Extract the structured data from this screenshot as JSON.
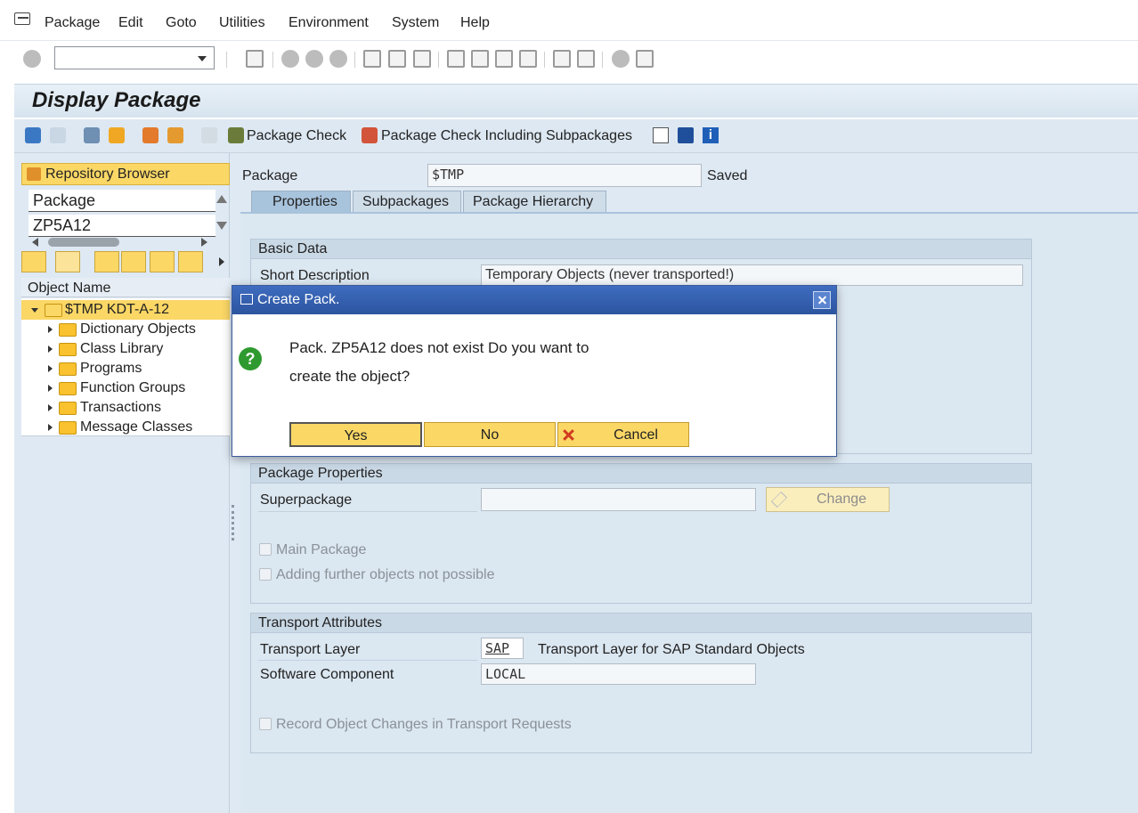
{
  "menu": {
    "items": [
      {
        "label": "Package",
        "u": "P"
      },
      {
        "label": "Edit",
        "u": "E"
      },
      {
        "label": "Goto",
        "u": "G"
      },
      {
        "label": "Utilities"
      },
      {
        "label": "Environment",
        "u": "n"
      },
      {
        "label": "System",
        "u": "S"
      },
      {
        "label": "Help",
        "u": "H"
      }
    ]
  },
  "toolbar": {
    "command_field": ""
  },
  "page": {
    "title": "Display Package"
  },
  "app_toolbar": {
    "package_check": "Package Check",
    "package_check_sub": "Package Check Including Subpackages"
  },
  "left": {
    "repo_button": "Repository Browser",
    "object_type": "Package",
    "object_name": "ZP5A12",
    "column_header": "Object Name",
    "tree": [
      {
        "label": "$TMP KDT-A-12",
        "expanded": true,
        "selected": true
      },
      {
        "label": "Dictionary Objects"
      },
      {
        "label": "Class Library"
      },
      {
        "label": "Programs"
      },
      {
        "label": "Function Groups"
      },
      {
        "label": "Transactions"
      },
      {
        "label": "Message Classes"
      }
    ]
  },
  "header": {
    "package_label": "Package",
    "package_value": "$TMP",
    "status": "Saved"
  },
  "tabs": [
    {
      "label": "Properties",
      "active": true
    },
    {
      "label": "Subpackages"
    },
    {
      "label": "Package Hierarchy"
    }
  ],
  "basic_data": {
    "title": "Basic Data",
    "short_desc_label": "Short Description",
    "short_desc_value": "Temporary Objects (never transported!)"
  },
  "package_props": {
    "title": "Package Properties",
    "superpackage_label": "Superpackage",
    "superpackage_value": "",
    "change_button": "Change",
    "main_package": "Main Package",
    "adding_further": "Adding further objects not possible"
  },
  "transport": {
    "title": "Transport Attributes",
    "layer_label": "Transport Layer",
    "layer_value": "SAP",
    "layer_desc": "Transport Layer for SAP Standard Objects",
    "sw_label": "Software Component",
    "sw_value": "LOCAL",
    "record_changes": "Record Object Changes in Transport Requests"
  },
  "dialog": {
    "title": "Create Pack.",
    "line1": "Pack. ZP5A12 does not exist Do you want to",
    "line2": "create the object?",
    "yes": "Yes",
    "no": "No",
    "cancel": "Cancel"
  },
  "colors": {
    "accent_yellow": "#fbd766",
    "dialog_title": "#2f5aa6",
    "background_blue": "#dfe9f3"
  }
}
